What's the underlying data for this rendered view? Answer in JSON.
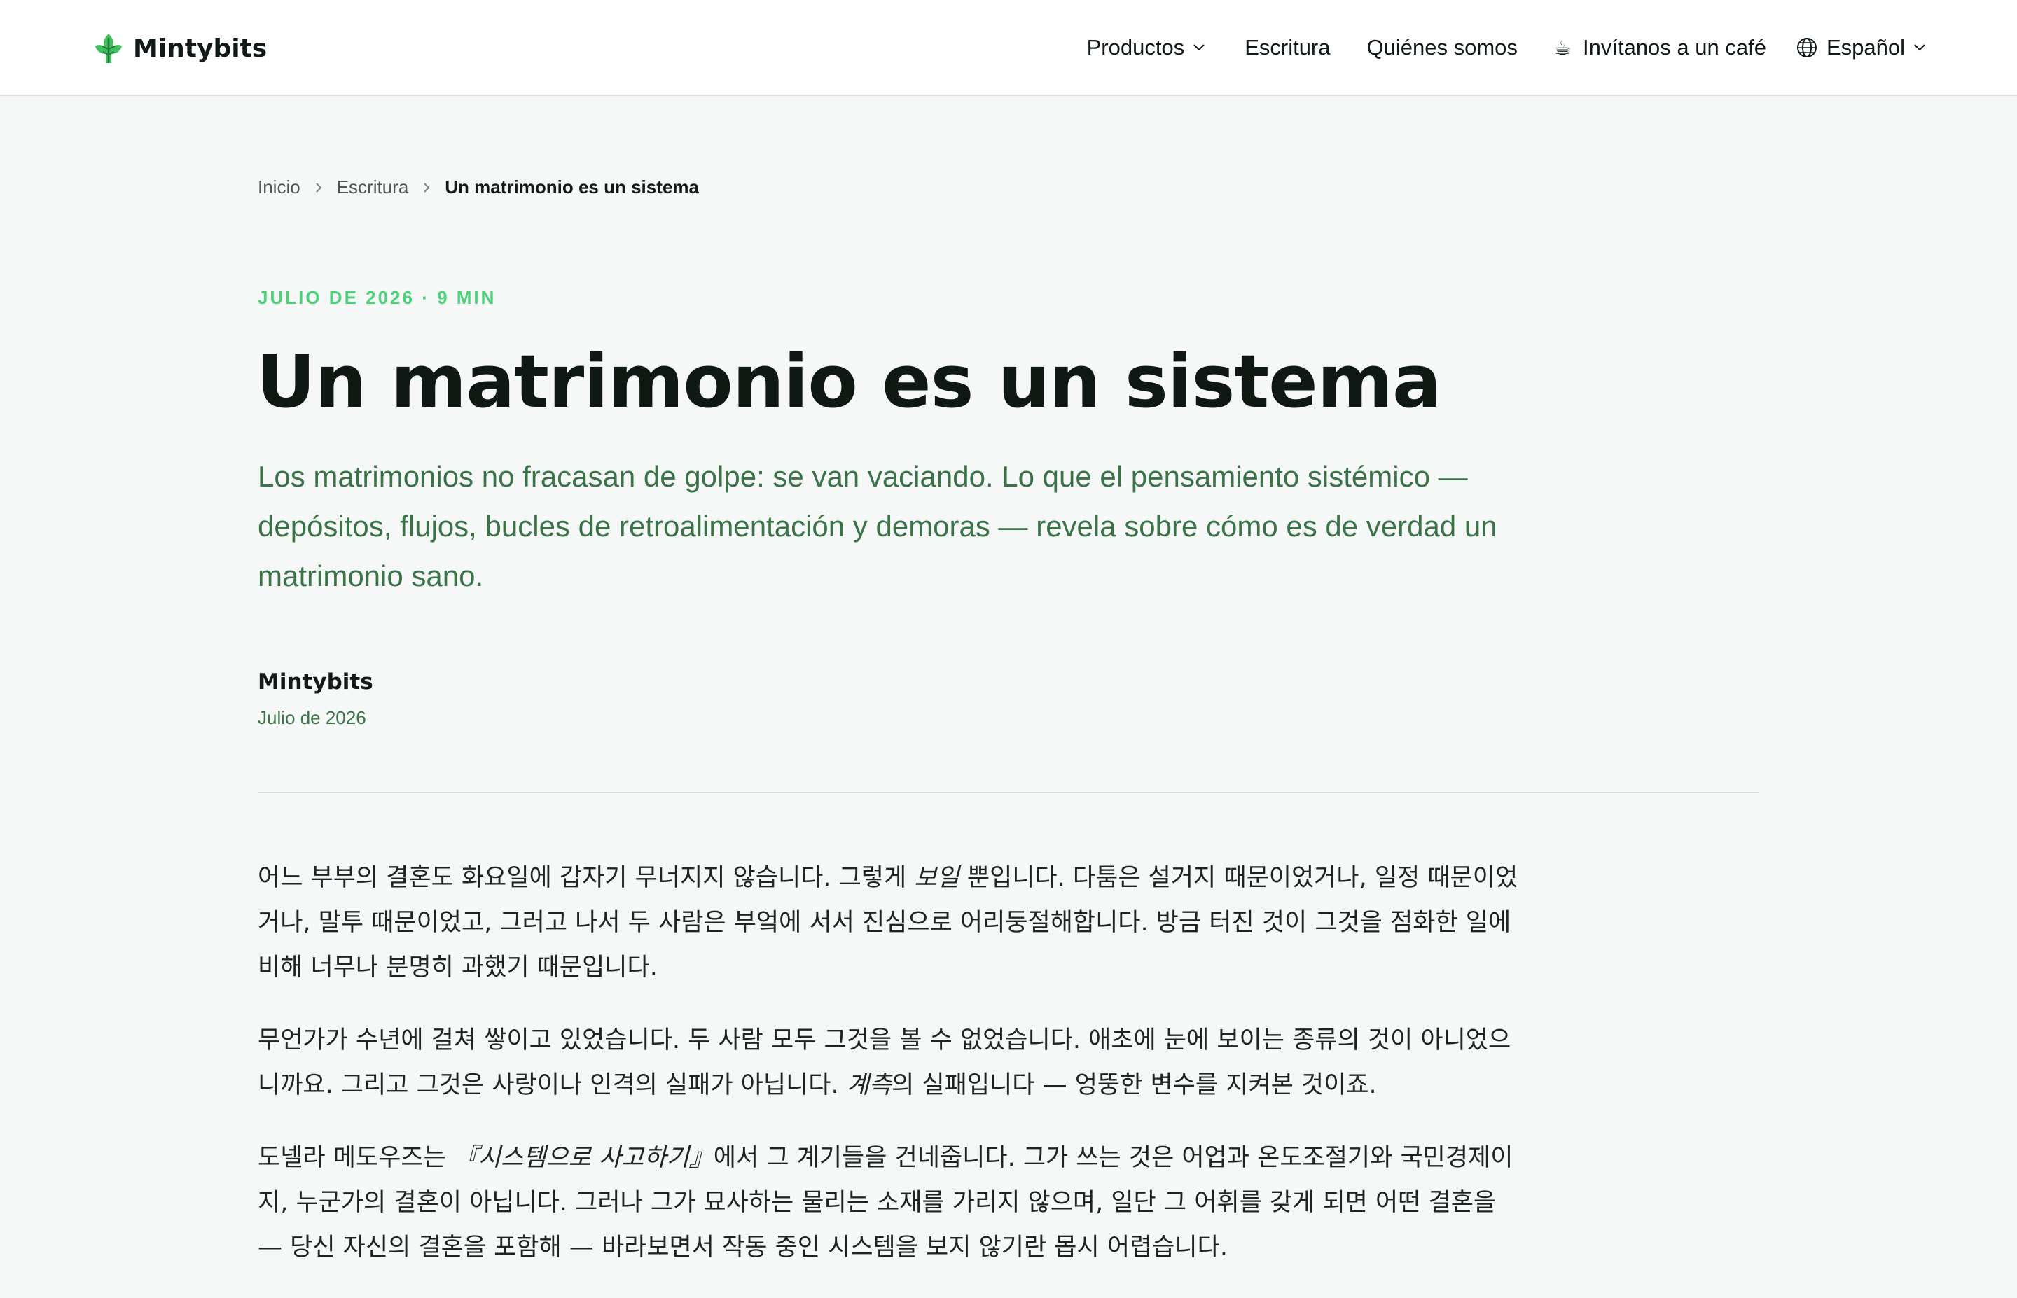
{
  "header": {
    "brand_name": "Mintybits",
    "nav": {
      "products": "Productos",
      "writing": "Escritura",
      "about": "Quiénes somos",
      "coffee_glyph": "☕",
      "coffee": "Invítanos a un café",
      "language": "Español"
    }
  },
  "breadcrumb": {
    "home": "Inicio",
    "section": "Escritura",
    "current": "Un matrimonio es un sistema"
  },
  "article": {
    "meta": "JULIO DE 2026 · 9 MIN",
    "title": "Un matrimonio es un sistema",
    "lede": "Los matrimonios no fracasan de golpe: se van vaciando. Lo que el pensamiento sistémico — depósitos, flujos, bucles de retroalimentación y demoras — revela sobre cómo es de verdad un matrimonio sano.",
    "author": "Mintybits",
    "date": "Julio de 2026",
    "paragraphs": [
      {
        "p1_a": "어느 부부의 결혼도 화요일에 갑자기 무너지지 않습니다. 그렇게 ",
        "p1_em": "보일",
        "p1_b": " 뿐입니다. 다툼은 설거지 때문이었거나, 일정 때문이었거나, 말투 때문이었고, 그러고 나서 두 사람은 부엌에 서서 진심으로 어리둥절해합니다. 방금 터진 것이 그것을 점화한 일에 비해 너무나 분명히 과했기 때문입니다."
      },
      {
        "p2_a": "무언가가 수년에 걸쳐 쌓이고 있었습니다. 두 사람 모두 그것을 볼 수 없었습니다. 애초에 눈에 보이는 종류의 것이 아니었으니까요. 그리고 그것은 사랑이나 인격의 실패가 아닙니다. ",
        "p2_em": "계측",
        "p2_b": "의 실패입니다 — 엉뚱한 변수를 지켜본 것이죠."
      },
      {
        "p3_a": "도넬라 메도우즈는 ",
        "p3_em": "『시스템으로 사고하기』",
        "p3_b": "에서 그 계기들을 건네줍니다. 그가 쓰는 것은 어업과 온도조절기와 국민경제이지, 누군가의 결혼이 아닙니다. 그러나 그가 묘사하는 물리는 소재를 가리지 않으며, 일단 그 어휘를 갖게 되면 어떤 결혼을 — 당신 자신의 결혼을 포함해 — 바라보면서 작동 중인 시스템을 보지 않기란 몹시 어렵습니다."
      }
    ]
  },
  "colors": {
    "accent_green": "#4cd079",
    "lede_green": "#3a7347",
    "background": "#f6f8f7",
    "header_bg": "#ffffff",
    "text": "#0f1813"
  },
  "icons": {
    "logo": "leaf-logo-icon",
    "products_dropdown": "chevron-down-icon",
    "coffee": "coffee-cup-icon",
    "language": "globe-icon",
    "language_dropdown": "chevron-down-icon",
    "breadcrumb_separator": "chevron-right-icon"
  }
}
